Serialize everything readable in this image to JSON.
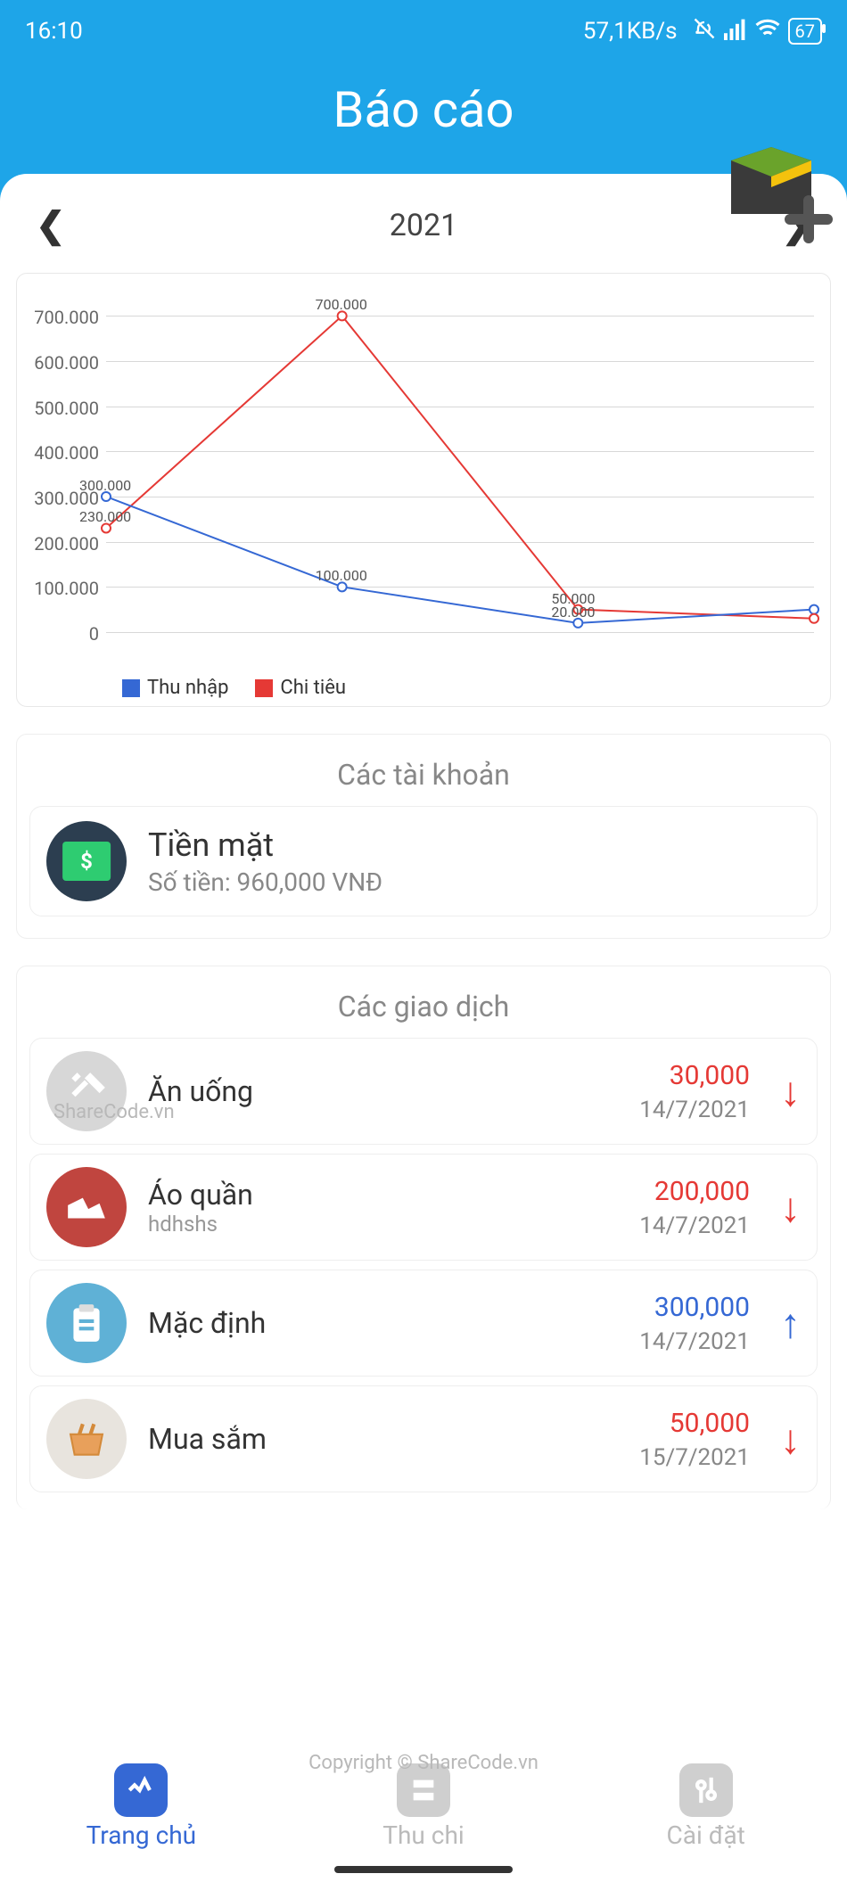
{
  "status": {
    "time": "16:10",
    "net": "57,1KB/s",
    "battery": "67"
  },
  "badge": "SHARECODE.vn",
  "header": {
    "title": "Báo cáo"
  },
  "year": {
    "label": "2021"
  },
  "chart_data": {
    "type": "line",
    "x": [
      1,
      2,
      3,
      4
    ],
    "series": [
      {
        "name": "Thu nhập",
        "color": "#3568d4",
        "values": [
          300000,
          100000,
          20000,
          50000
        ]
      },
      {
        "name": "Chi tiêu",
        "color": "#e53935",
        "values": [
          230000,
          700000,
          50000,
          30000
        ]
      }
    ],
    "y_ticks": [
      0,
      100000,
      200000,
      300000,
      400000,
      500000,
      600000,
      700000
    ],
    "y_tick_labels": [
      "0",
      "100.000",
      "200.000",
      "300.000",
      "400.000",
      "500.000",
      "600.000",
      "700.000"
    ],
    "point_labels": {
      "thu_nhap": [
        "300.000",
        "100.000",
        "20.000",
        ""
      ],
      "chi_tieu": [
        "230.000",
        "700.000",
        "50.000",
        ""
      ]
    },
    "ylim": [
      0,
      750000
    ]
  },
  "accounts": {
    "title": "Các tài khoản",
    "items": [
      {
        "name": "Tiền mặt",
        "sub": "Số tiền: 960,000 VNĐ"
      }
    ]
  },
  "transactions": {
    "title": "Các giao dịch",
    "items": [
      {
        "title": "Ăn uống",
        "sub": "",
        "amount": "30,000",
        "date": "14/7/2021",
        "dir": "down",
        "icon": "food",
        "color": "#d7d7d7"
      },
      {
        "title": "Áo quần",
        "sub": "hdhshs",
        "amount": "200,000",
        "date": "14/7/2021",
        "dir": "down",
        "icon": "shoe",
        "color": "#c0453f"
      },
      {
        "title": "Mặc định",
        "sub": "",
        "amount": "300,000",
        "date": "14/7/2021",
        "dir": "up",
        "icon": "clip",
        "color": "#5fb1d6"
      },
      {
        "title": "Mua sắm",
        "sub": "",
        "amount": "50,000",
        "date": "15/7/2021",
        "dir": "down",
        "icon": "basket",
        "color": "#e8e4de"
      }
    ]
  },
  "tabs": [
    {
      "label": "Trang chủ",
      "active": true,
      "icon": "home"
    },
    {
      "label": "Thu chi",
      "active": false,
      "icon": "inout"
    },
    {
      "label": "Cài đặt",
      "active": false,
      "icon": "gear"
    }
  ],
  "watermarks": {
    "wm1": "ShareCode.vn",
    "wm2": "Copyright © ShareCode.vn"
  }
}
